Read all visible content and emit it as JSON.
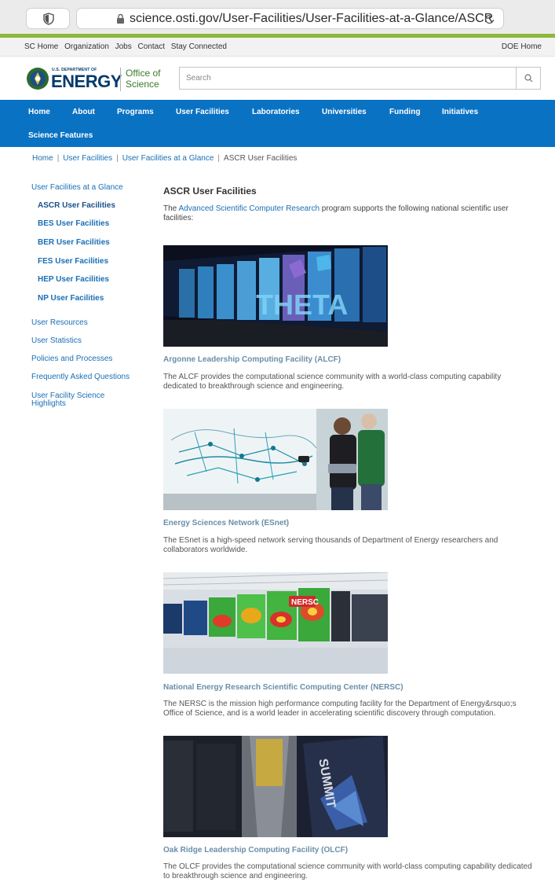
{
  "browser": {
    "url": "science.osti.gov/User-Facilities/User-Facilities-at-a-Glance/ASCR",
    "icons": [
      "shield-icon",
      "lock-icon",
      "reload-icon"
    ]
  },
  "utility": {
    "links": [
      "SC Home",
      "Organization",
      "Jobs",
      "Contact",
      "Stay Connected"
    ],
    "doe_home": "DOE Home"
  },
  "header": {
    "logo_small": "U.S. DEPARTMENT OF",
    "logo_energy": "ENERGY",
    "office_line1": "Office of",
    "office_line2": "Science",
    "search_placeholder": "Search"
  },
  "nav": {
    "items": [
      "Home",
      "About",
      "Programs",
      "User Facilities",
      "Laboratories",
      "Universities",
      "Funding",
      "Initiatives",
      "Science Features"
    ]
  },
  "breadcrumb": {
    "items": [
      "Home",
      "User Facilities",
      "User Facilities at a Glance",
      "ASCR User Facilities"
    ]
  },
  "sidebar": {
    "items": [
      "User Facilities at a Glance",
      "ASCR User Facilities",
      "BES User Facilities",
      "BER User Facilities",
      "FES User Facilities",
      "HEP User Facilities",
      "NP User Facilities",
      "User Resources",
      "User Statistics",
      "Policies and Processes",
      "Frequently Asked Questions",
      "User Facility Science Highlights"
    ]
  },
  "main": {
    "title": "ASCR User Facilities",
    "intro_prefix": "The ",
    "intro_link": "Advanced Scientific Computer Research",
    "intro_suffix": " program supports the following national scientific user facilities:",
    "facilities": [
      {
        "title": "Argonne Leadership Computing Facility (ALCF)",
        "desc": "The ALCF provides the computational science community with a world-class computing capability dedicated to breakthrough science and engineering.",
        "image_text": "THETA"
      },
      {
        "title": "Energy Sciences Network (ESnet)",
        "desc": "The ESnet is a high-speed network serving thousands of Department of Energy researchers and collaborators worldwide."
      },
      {
        "title": "National Energy Research Scientific Computing Center (NERSC)",
        "desc": "The NERSC is the mission high performance computing facility for the Department of Energy&rsquo;s Office of Science, and is a world leader in accelerating scientific discovery through computation.",
        "image_text": "NERSC"
      },
      {
        "title": "Oak Ridge Leadership Computing Facility (OLCF)",
        "desc": "The OLCF provides the computational science community with world-class computing capability dedicated to breakthrough science and engineering.",
        "image_text": "SUMMIT"
      }
    ]
  }
}
